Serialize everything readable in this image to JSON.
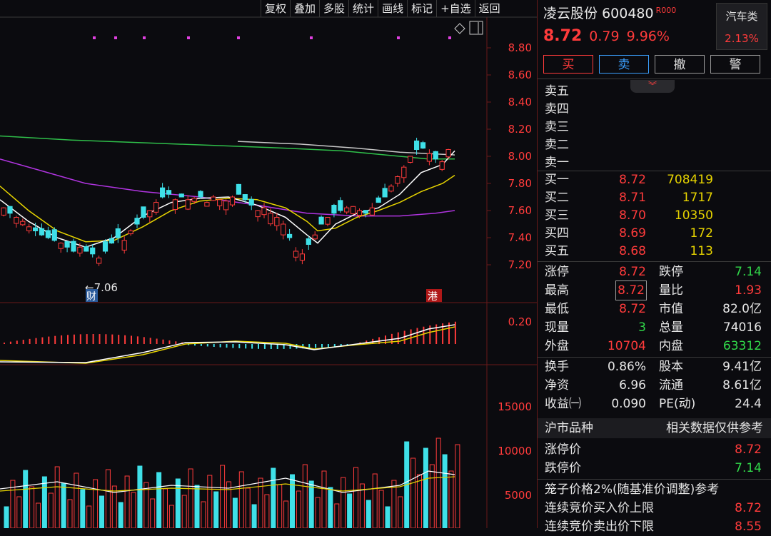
{
  "toolbar": [
    "复权",
    "叠加",
    "多股",
    "统计",
    "画线",
    "标记",
    "+自选",
    "返回"
  ],
  "chart": {
    "price_axis": [
      "8.80",
      "8.60",
      "8.40",
      "8.20",
      "8.00",
      "7.80",
      "7.60",
      "7.40",
      "7.20"
    ],
    "macd_axis": [
      "0.20"
    ],
    "vol_axis": [
      "15000",
      "10000",
      "5000"
    ],
    "low_marker": "←7.06",
    "badge_cai": "财",
    "badge_gang": "港",
    "colors": {
      "up": "#ff3b3b",
      "down": "#3fe0e8",
      "ma5": "#ffffff",
      "ma10": "#e6d300",
      "ma60": "#b034e0",
      "ma120": "#2fbf4a",
      "ma250": "#c8c8c8"
    }
  },
  "stock": {
    "name": "凌云股份",
    "code": "600480",
    "rz": "R000",
    "price": "8.72",
    "change": "0.79",
    "pct": "9.96%",
    "sector_name": "汽车类",
    "sector_pct": "2.13%"
  },
  "buttons": {
    "buy": "买",
    "sell": "卖",
    "cancel": "撤",
    "alert": "警"
  },
  "collapse_icon": "chevron-down-double-icon",
  "asks": [
    {
      "label": "卖五",
      "price": "",
      "vol": ""
    },
    {
      "label": "卖四",
      "price": "",
      "vol": ""
    },
    {
      "label": "卖三",
      "price": "",
      "vol": ""
    },
    {
      "label": "卖二",
      "price": "",
      "vol": ""
    },
    {
      "label": "卖一",
      "price": "",
      "vol": ""
    }
  ],
  "bids": [
    {
      "label": "买一",
      "price": "8.72",
      "vol": "708419"
    },
    {
      "label": "买二",
      "price": "8.71",
      "vol": "1717"
    },
    {
      "label": "买三",
      "price": "8.70",
      "vol": "10350"
    },
    {
      "label": "买四",
      "price": "8.69",
      "vol": "172"
    },
    {
      "label": "买五",
      "price": "8.68",
      "vol": "113"
    }
  ],
  "stats1": [
    {
      "k1": "涨停",
      "v1": "8.72",
      "c1": "red",
      "k2": "跌停",
      "v2": "7.14",
      "c2": "green"
    },
    {
      "k1": "最高",
      "v1": "8.72",
      "c1": "red",
      "k2": "量比",
      "v2": "1.93",
      "c2": "red"
    },
    {
      "k1": "最低",
      "v1": "8.72",
      "c1": "red",
      "k2": "市值",
      "v2": "82.0亿",
      "c2": "white"
    },
    {
      "k1": "现量",
      "v1": "3",
      "c1": "green",
      "k2": "总量",
      "v2": "74016",
      "c2": "white"
    },
    {
      "k1": "外盘",
      "v1": "10704",
      "c1": "red",
      "k2": "内盘",
      "v2": "63312",
      "c2": "green"
    }
  ],
  "stats2": [
    {
      "k1": "换手",
      "v1": "0.86%",
      "k2": "股本",
      "v2": "9.41亿"
    },
    {
      "k1": "净资",
      "v1": "6.96",
      "k2": "流通",
      "v2": "8.61亿"
    },
    {
      "k1": "收益㈠",
      "v1": "0.090",
      "k2": "PE(动)",
      "v2": "24.4"
    }
  ],
  "market": {
    "left": "沪市品种",
    "right": "相关数据仅供参考"
  },
  "limits": [
    {
      "k": "涨停价",
      "v": "8.72",
      "c": "red"
    },
    {
      "k": "跌停价",
      "v": "7.14",
      "c": "green"
    }
  ],
  "cage_title": "笼子价格2%(随基准价调整)参考",
  "cage": [
    {
      "k": "连续竞价买入价上限",
      "v": "8.72"
    },
    {
      "k": "连续竞价卖出价下限",
      "v": "8.55"
    }
  ]
}
